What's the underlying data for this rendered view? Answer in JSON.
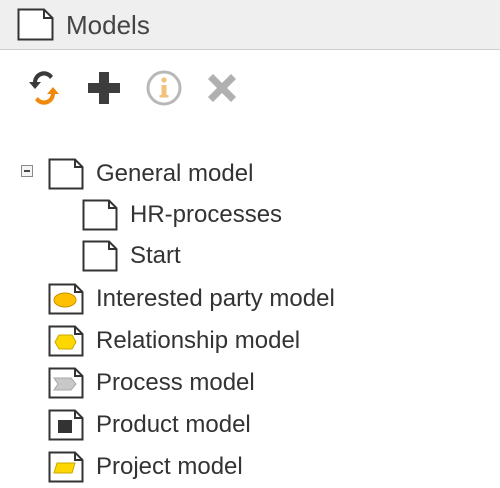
{
  "header": {
    "title": "Models",
    "icon": "document-icon"
  },
  "toolbar": {
    "buttons": [
      {
        "name": "refresh-button",
        "icon": "refresh-icon",
        "color": "#f08a0c"
      },
      {
        "name": "add-button",
        "icon": "plus-icon",
        "color": "#3d3d3d"
      },
      {
        "name": "info-button",
        "icon": "info-icon",
        "color": "#f2c27a"
      },
      {
        "name": "delete-button",
        "icon": "close-icon",
        "color": "#b0b0b0"
      }
    ]
  },
  "tree": {
    "root": {
      "label": "General model",
      "expanded": true,
      "icon": "document-icon"
    },
    "children": [
      {
        "label": "HR-processes",
        "icon": "document-icon"
      },
      {
        "label": "Start",
        "icon": "document-icon"
      }
    ],
    "items": [
      {
        "label": "Interested party model",
        "icon": "ellipse-model-icon",
        "color": "#ffc000"
      },
      {
        "label": "Relationship model",
        "icon": "hexagon-model-icon",
        "color": "#ffd700"
      },
      {
        "label": "Process model",
        "icon": "arrow-model-icon",
        "color": "#c8c8c8"
      },
      {
        "label": "Product model",
        "icon": "square-model-icon",
        "color": "#333333"
      },
      {
        "label": "Project model",
        "icon": "parallelogram-model-icon",
        "color": "#ffd700"
      }
    ]
  }
}
